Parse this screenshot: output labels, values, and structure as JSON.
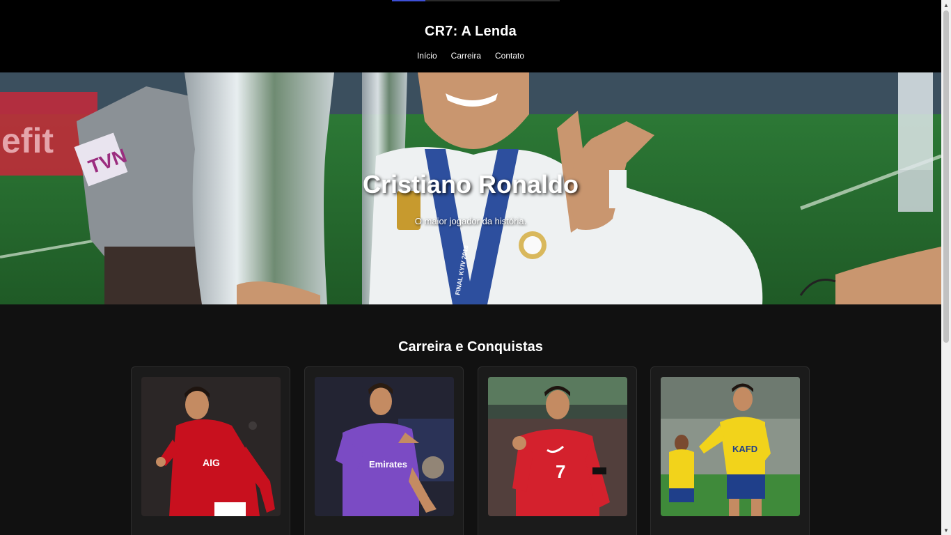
{
  "header": {
    "title": "CR7: A Lenda",
    "nav": [
      {
        "label": "Início"
      },
      {
        "label": "Carreira"
      },
      {
        "label": "Contato"
      }
    ]
  },
  "scroll_progress": 0.2,
  "hero": {
    "title": "Cristiano Ronaldo",
    "subtitle": "O maior jogador da história.",
    "photo": {
      "medal_text": "FINAL KYIV 2018",
      "banner_text": "TVN",
      "ad_text": "efit"
    }
  },
  "career": {
    "title": "Carreira e Conquistas",
    "cards": [
      {
        "kit_color": "#c8101e",
        "sponsor": "AIG",
        "number": ""
      },
      {
        "kit_color": "#7b4bc4",
        "sponsor": "Emirates",
        "number": ""
      },
      {
        "kit_color": "#d4212d",
        "sponsor": "",
        "number": "7"
      },
      {
        "kit_color": "#f2d31b",
        "sponsor": "KAFD",
        "number": ""
      }
    ]
  },
  "colors": {
    "header_bg": "#000000",
    "page_bg": "#111111",
    "card_bg": "#1b1b1b",
    "progress": "#3d4fd6"
  }
}
